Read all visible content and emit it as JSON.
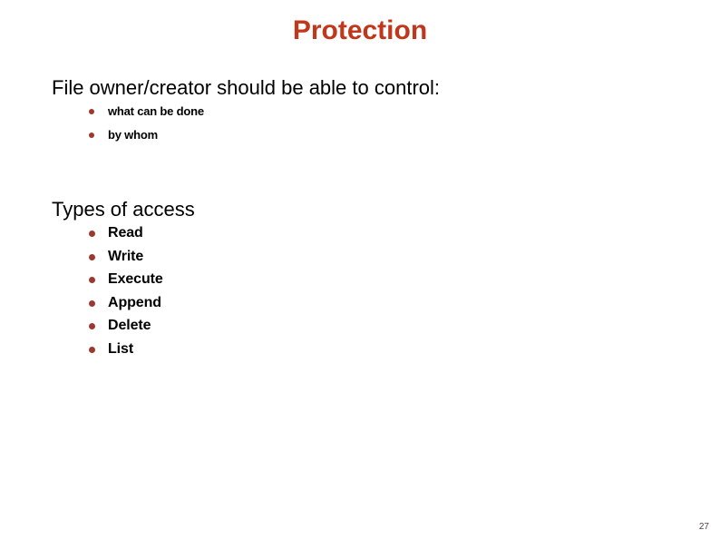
{
  "slide": {
    "title": "Protection",
    "title_color": "#c0371b",
    "background_color": "#ffffff",
    "bullet_color": "#9c3830",
    "text_color": "#000000",
    "page_number": "27",
    "page_number_color": "#4d4440"
  },
  "sections": [
    {
      "heading": "File owner/creator should be able to control:",
      "items": [
        {
          "label": "what can be done"
        },
        {
          "label": "by whom"
        }
      ]
    },
    {
      "heading": "Types of access",
      "items": [
        {
          "label": "Read"
        },
        {
          "label": "Write"
        },
        {
          "label": "Execute"
        },
        {
          "label": "Append"
        },
        {
          "label": "Delete"
        },
        {
          "label": "List"
        }
      ]
    }
  ]
}
